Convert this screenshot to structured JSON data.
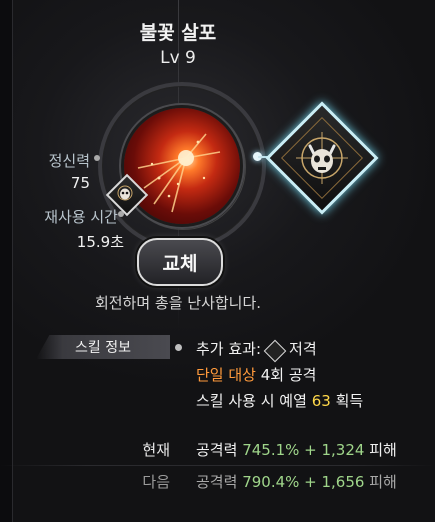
{
  "skill": {
    "name": "불꽃 살포",
    "level": "Lv 9",
    "description": "회전하며 총을 난사합니다.",
    "orb_icon": "flame-burst-icon",
    "linked_icon": "demon-skull-target-icon"
  },
  "stats": {
    "spirit_label": "정신력",
    "spirit_value": "75",
    "cooldown_label": "재사용 시간",
    "cooldown_value": "15.9초"
  },
  "replace_button": {
    "label": "교체"
  },
  "info": {
    "section_label": "스킬 정보",
    "bonus_prefix": "추가 효과:",
    "bonus_name": "저격",
    "target_type": "단일 대상",
    "hit_count": "4회 공격",
    "gain_text": "스킬 사용 시 예열",
    "gain_value": "63",
    "gain_suffix": "획득"
  },
  "damage": {
    "current_label": "현재",
    "current_prefix": "공격력",
    "current_value": "745.1% + 1,324",
    "current_suffix": "피해",
    "next_label": "다음",
    "next_prefix": "공격력",
    "next_value": "790.4% + 1,656",
    "next_suffix": "피해"
  },
  "colors": {
    "accent_orange": "#ff9a3c",
    "accent_yellow": "#ffd84a",
    "accent_green": "#9fd58a",
    "frame_cyan": "#c9eef6"
  }
}
